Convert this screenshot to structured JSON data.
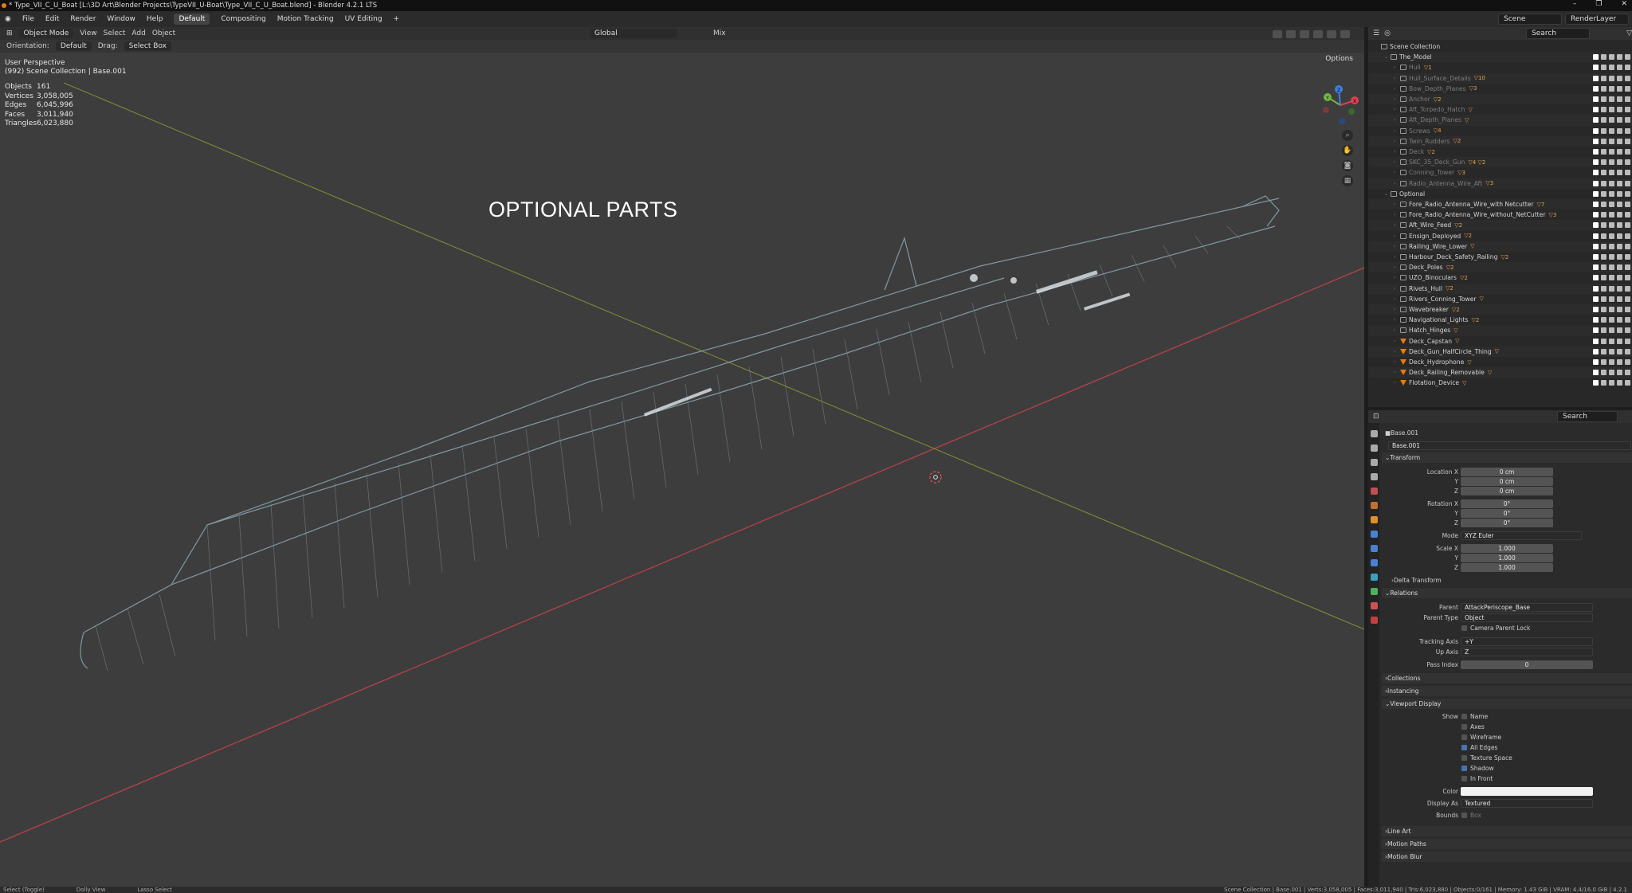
{
  "titlebar": {
    "title": "* Type_VII_C_U_Boat [L:\\3D Art\\Blender Projects\\TypeVII_U-Boat\\Type_VII_C_U_Boat.blend] - Blender 4.2.1 LTS",
    "min": "–",
    "max": "❐",
    "close": "✕"
  },
  "menu": {
    "items": [
      "File",
      "Edit",
      "Render",
      "Window",
      "Help"
    ],
    "workspaces": [
      "Default",
      "Compositing",
      "Motion Tracking",
      "UV Editing",
      "+"
    ],
    "scene": "Scene",
    "layer": "RenderLayer"
  },
  "viewport": {
    "mode": "Object Mode",
    "view": "View",
    "select": "Select",
    "add": "Add",
    "object": "Object",
    "transform": "Global",
    "mix": "Mix",
    "orientation_label": "Orientation:",
    "orientation": "Default",
    "drag_label": "Drag:",
    "drag": "Select Box",
    "options": "Options",
    "view_name": "User Perspective",
    "collection": "(992) Scene Collection | Base.001",
    "stats": [
      {
        "k": "Objects",
        "v": "161"
      },
      {
        "k": "Vertices",
        "v": "3,058,005"
      },
      {
        "k": "Edges",
        "v": "6,045,996"
      },
      {
        "k": "Faces",
        "v": "3,011,940"
      },
      {
        "k": "Triangles",
        "v": "6,023,880"
      }
    ],
    "overlay_text": "OPTIONAL PARTS",
    "gizmo": {
      "x": "X",
      "y": "Y",
      "z": "Z"
    }
  },
  "outliner": {
    "search_placeholder": "Search",
    "rows": [
      {
        "name": "Scene Collection",
        "depth": 0,
        "type": "coll",
        "dim": false,
        "tags": ""
      },
      {
        "name": "The_Model",
        "depth": 1,
        "type": "coll",
        "dim": false,
        "tags": ""
      },
      {
        "name": "Hull",
        "depth": 2,
        "type": "coll",
        "dim": true,
        "tags": "▽1"
      },
      {
        "name": "Hull_Surface_Details",
        "depth": 2,
        "type": "coll",
        "dim": true,
        "tags": "▽10"
      },
      {
        "name": "Bow_Depth_Planes",
        "depth": 2,
        "type": "coll",
        "dim": true,
        "tags": "▽3"
      },
      {
        "name": "Anchor",
        "depth": 2,
        "type": "coll",
        "dim": true,
        "tags": "▽2"
      },
      {
        "name": "Aft_Torpedo_Hatch",
        "depth": 2,
        "type": "coll",
        "dim": true,
        "tags": "▽"
      },
      {
        "name": "Aft_Depth_Planes",
        "depth": 2,
        "type": "coll",
        "dim": true,
        "tags": "▽"
      },
      {
        "name": "Screws",
        "depth": 2,
        "type": "coll",
        "dim": true,
        "tags": "▽4"
      },
      {
        "name": "Twin_Rudders",
        "depth": 2,
        "type": "coll",
        "dim": true,
        "tags": "▽2"
      },
      {
        "name": "Deck",
        "depth": 2,
        "type": "coll",
        "dim": true,
        "tags": "▽2"
      },
      {
        "name": "SKC_35_Deck_Gun",
        "depth": 2,
        "type": "coll",
        "dim": true,
        "tags": "▽4 ▽2"
      },
      {
        "name": "Conning_Tower",
        "depth": 2,
        "type": "coll",
        "dim": true,
        "tags": "▽3"
      },
      {
        "name": "Radio_Antenna_Wire_Aft",
        "depth": 2,
        "type": "coll",
        "dim": true,
        "tags": "▽3"
      },
      {
        "name": "Optional",
        "depth": 1,
        "type": "coll",
        "dim": false,
        "tags": ""
      },
      {
        "name": "Fore_Radio_Antenna_Wire_with Netcutter",
        "depth": 2,
        "type": "coll",
        "dim": false,
        "tags": "▽7"
      },
      {
        "name": "Fore_Radio_Antenna_Wire_without_NetCutter",
        "depth": 2,
        "type": "coll",
        "dim": false,
        "tags": "▽3"
      },
      {
        "name": "Aft_Wire_Feed",
        "depth": 2,
        "type": "coll",
        "dim": false,
        "tags": "▽2"
      },
      {
        "name": "Ensign_Deployed",
        "depth": 2,
        "type": "coll",
        "dim": false,
        "tags": "▽2"
      },
      {
        "name": "Railing_Wire_Lower",
        "depth": 2,
        "type": "coll",
        "dim": false,
        "tags": "▽"
      },
      {
        "name": "Harbour_Deck_Safety_Railing",
        "depth": 2,
        "type": "coll",
        "dim": false,
        "tags": "▽2"
      },
      {
        "name": "Deck_Poles",
        "depth": 2,
        "type": "coll",
        "dim": false,
        "tags": "▽2"
      },
      {
        "name": "UZO_Binoculars",
        "depth": 2,
        "type": "coll",
        "dim": false,
        "tags": "▽2"
      },
      {
        "name": "Rivets_Hull",
        "depth": 2,
        "type": "coll",
        "dim": false,
        "tags": "▽2"
      },
      {
        "name": "Rivers_Conning_Tower",
        "depth": 2,
        "type": "coll",
        "dim": false,
        "tags": "▽"
      },
      {
        "name": "Wavebreaker",
        "depth": 2,
        "type": "coll",
        "dim": false,
        "tags": "▽2"
      },
      {
        "name": "Navigational_Lights",
        "depth": 2,
        "type": "coll",
        "dim": false,
        "tags": "▽2"
      },
      {
        "name": "Hatch_Hinges",
        "depth": 2,
        "type": "coll",
        "dim": false,
        "tags": "▽"
      },
      {
        "name": "Deck_Capstan",
        "depth": 2,
        "type": "mesh",
        "dim": false,
        "tags": "▽"
      },
      {
        "name": "Deck_Gun_HalfCircle_Thing",
        "depth": 2,
        "type": "mesh",
        "dim": false,
        "tags": "▽"
      },
      {
        "name": "Deck_Hydrophone",
        "depth": 2,
        "type": "mesh",
        "dim": false,
        "tags": "▽"
      },
      {
        "name": "Deck_Railing_Removable",
        "depth": 2,
        "type": "mesh",
        "dim": false,
        "tags": "▽"
      },
      {
        "name": "Flotation_Device",
        "depth": 2,
        "type": "mesh",
        "dim": false,
        "tags": "▽"
      }
    ]
  },
  "props": {
    "search_placeholder": "Search",
    "object": "Base.001",
    "object_name": "Base.001",
    "transform": "Transform",
    "loc_x_label": "Location X",
    "loc_x": "0 cm",
    "y_label": "Y",
    "loc_y": "0 cm",
    "z_label": "Z",
    "loc_z": "0 cm",
    "rot_x_label": "Rotation X",
    "rot_x": "0°",
    "rot_y": "0°",
    "rot_z": "0°",
    "mode_label": "Mode",
    "mode": "XYZ Euler",
    "scale_x_label": "Scale X",
    "scale_x": "1.000",
    "scale_y": "1.000",
    "scale_z": "1.000",
    "delta": "Delta Transform",
    "relations": "Relations",
    "parent_label": "Parent",
    "parent": "AttackPeriscope_Base",
    "parent_type_label": "Parent Type",
    "parent_type": "Object",
    "camera_lock": "Camera Parent Lock",
    "tracking_label": "Tracking Axis",
    "tracking": "+Y",
    "up_label": "Up Axis",
    "up": "Z",
    "pass_label": "Pass Index",
    "pass": "0",
    "collections": "Collections",
    "instancing": "Instancing",
    "viewport_display": "Viewport Display",
    "show_label": "Show",
    "name_opt": "Name",
    "axes": "Axes",
    "wireframe": "Wireframe",
    "all_edges": "All Edges",
    "texture_space": "Texture Space",
    "shadow": "Shadow",
    "in_front": "In Front",
    "color_label": "Color",
    "display_as_label": "Display As",
    "display_as": "Textured",
    "bounds_label": "Bounds",
    "bounds": "Box",
    "line_art": "Line Art",
    "motion_paths": "Motion Paths",
    "motion_blur": "Motion Blur"
  },
  "status": {
    "left": "Select (Toggle)",
    "mid": "Dolly View",
    "mid2": "Lasso Select",
    "right": "Scene Collection | Base.001 | Verts:3,058,005 | Faces:3,011,940 | Tris:6,023,880 | Objects:0/161 | Memory: 1.43 GiB | VRAM: 4.4/16.0 GiB | 4.2.1"
  }
}
